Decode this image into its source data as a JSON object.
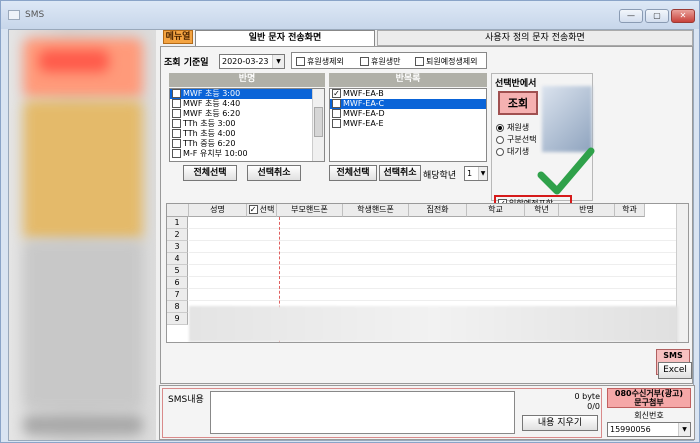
{
  "window": {
    "title": "SMS",
    "btn_min": "—",
    "btn_max": "▢",
    "btn_close": "✕"
  },
  "menu_label": "메뉴열",
  "tabs": {
    "active": "일반 문자 전송화면",
    "inactive": "사용자 정의 문자 전송화면"
  },
  "query": {
    "label": "조회 기준일",
    "date": "2020-03-23"
  },
  "filters": [
    {
      "label": "휴원생제외",
      "checked": false
    },
    {
      "label": "휴원생만",
      "checked": false
    },
    {
      "label": "퇴원예정생제외",
      "checked": false
    }
  ],
  "class_list": {
    "header": "반명",
    "items": [
      {
        "label": "MWF 초등 3:00",
        "checked": true,
        "selected": true
      },
      {
        "label": "MWF 초등 4:40",
        "checked": false,
        "selected": false
      },
      {
        "label": "MWF 초등 6:20",
        "checked": false,
        "selected": false
      },
      {
        "label": "TTh 초등 3:00",
        "checked": false,
        "selected": false
      },
      {
        "label": "TTh 초등 4:00",
        "checked": false,
        "selected": false
      },
      {
        "label": "TTh 중등 6:20",
        "checked": false,
        "selected": false
      },
      {
        "label": "M-F 유치부 10:00",
        "checked": false,
        "selected": false
      }
    ],
    "select_all": "전체선택",
    "deselect": "선택취소"
  },
  "repeat_list": {
    "header": "반목록",
    "items": [
      {
        "label": "MWF-EA-B",
        "checked": true,
        "selected": false
      },
      {
        "label": "MWF-EA-C",
        "checked": true,
        "selected": true
      },
      {
        "label": "MWF-EA-D",
        "checked": false,
        "selected": false
      },
      {
        "label": "MWF-EA-E",
        "checked": false,
        "selected": false
      }
    ],
    "select_all": "전체선택",
    "deselect": "선택취소",
    "grade_label": "해당학년",
    "grade_value": "1"
  },
  "selection_panel": {
    "title": "선택반에서",
    "query_button": "조회",
    "radios": [
      {
        "label": "재원생",
        "checked": true
      },
      {
        "label": "구분선택",
        "checked": false
      },
      {
        "label": "대기생",
        "checked": false
      }
    ],
    "include_checkbox": {
      "label": "입학예정포함",
      "checked": true
    }
  },
  "grid": {
    "columns": [
      "성명",
      "선택",
      "부모핸드폰",
      "학생핸드폰",
      "집전화",
      "학교",
      "학년",
      "반명",
      "학과"
    ],
    "row_numbers": [
      "1",
      "2",
      "3",
      "4",
      "5",
      "6",
      "7",
      "8",
      "9"
    ]
  },
  "side_buttons": {
    "sms_send": "SMS\n발송",
    "excel": "Excel"
  },
  "bottom": {
    "sms_label": "SMS내용",
    "byte_count": "0 byte",
    "ratio": "0/0",
    "clear_button": "내용 지우기",
    "opt_out_title": "080수신거부(광고)\n문구첨부",
    "callback_label": "회신번호",
    "callback_number": "15990056"
  },
  "colors": {
    "accent_red": "#d61a1a",
    "selection_blue": "#0a64d8",
    "check_green": "#2fa14a",
    "menu_orange": "#f4a442"
  }
}
